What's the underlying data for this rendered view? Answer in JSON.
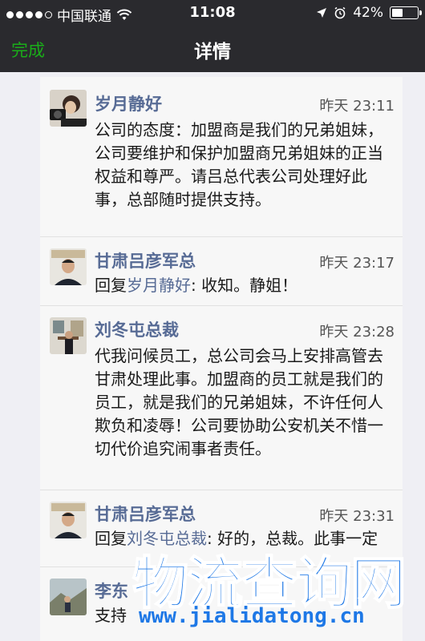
{
  "status_bar": {
    "carrier": "中国联通",
    "time": "11:08",
    "battery": "42%",
    "battery_level": 0.42
  },
  "nav": {
    "done_label": "完成",
    "title": "详情"
  },
  "comments": [
    {
      "name": "岁月静好",
      "time": "昨天 23:11",
      "text": "公司的态度：加盟商是我们的兄弟姐妹，公司要维护和保护加盟商兄弟姐妹的正当权益和尊严。请吕总代表公司处理好此事，总部随时提供支持。"
    },
    {
      "name": "甘肃吕彦军总",
      "time": "昨天 23:17",
      "reply_prefix": "回复",
      "reply_to": "岁月静好",
      "text": ": 收知。静姐！"
    },
    {
      "name": "刘冬屯总裁",
      "time": "昨天 23:28",
      "text": "代我问候员工，总公司会马上安排高管去甘肃处理此事。加盟商的员工就是我们的员工，就是我们的兄弟姐妹，不许任何人欺负和凌辱！公司要协助公安机关不惜一切代价追究闹事者责任。"
    },
    {
      "name": "甘肃吕彦军总",
      "time": "昨天 23:31",
      "reply_prefix": "回复",
      "reply_to": "刘冬屯总裁",
      "text": ": 好的，总裁。此事一定"
    },
    {
      "name": "李东",
      "time": "",
      "text": "支持"
    }
  ],
  "watermark": {
    "title": "物流查询网",
    "url": "www.jialidatong.cn"
  },
  "colors": {
    "header_bg": "#2a2a2e",
    "done_green": "#1aad19",
    "name_blue": "#576b95",
    "watermark_blue": "#1e78e6"
  }
}
